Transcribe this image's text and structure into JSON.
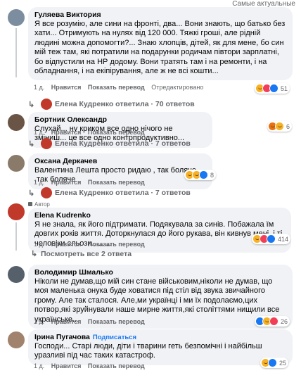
{
  "top_fragment": "Самые актуальные",
  "comments": [
    {
      "author": "Гуляева Виктория",
      "text": "Я все розумію, але сини на фронті, два... Вони знають, що батько без хати... Отримують на нулях від 120 000. Тяжкі гроші, але рідній людині можна допомогти?... Знаю хлопців, дітей, як для мене, бо син мій теж там, які потратили на подарунки родичам півтори зарплатні, бо відпустили на НР додому. Вони тратять там і на ремонти, і на обладнання, і на екіпірування, але ж не всі кошти...",
      "time": "1 д.",
      "like": "Нравится",
      "translate": "Показать перевод",
      "edited": "Отредактировано",
      "reactions": "51",
      "reply_summary": "Елена Кудренко ответила · 70 ответов"
    },
    {
      "author": "Бортник Олександр",
      "text": "Слухай... ну криком все одно нічого не зміниш... це все одно контрпродуктивно...",
      "time": "1 д.",
      "like": "Нравится",
      "translate": "Показать перевод",
      "reactions": "6",
      "reply_summary": "Елена Кудренко ответила · 7 ответов"
    },
    {
      "author": "Оксана Деркачев",
      "text": "Валентина Лешта просто ридаю , так боляче ,так боляче",
      "time": "1 д.",
      "like": "Нравится",
      "translate": "Показать перевод",
      "reactions": "8",
      "reply_summary": "Елена Кудренко ответила · 7 ответов"
    },
    {
      "badge": "Автор",
      "author": "Elena Kudrenko",
      "text": "Я не знала, як його підтримати. Подякувала за синів. Побажала їм довгих років життя. Доторкнулася до його рукава, він кивнув мені, і ті чоловіки сльози.........",
      "time": "1 д.",
      "like": "Нравится",
      "translate": "Показать перевод",
      "reactions": "414",
      "more_replies": "Посмотреть все 2 ответа"
    },
    {
      "author": "Володимир Шмалько",
      "text": "Ніколи не думав,що мій син стане військовим,ніколи не думав, що моя маленька онука буде ховатися під стіл від звука звичайного грому. Але так сталося. Але,ми українці і ми їх подолаємо,цих потвор,які зруйнували наше мирне життя,які століттями нищили все українське...",
      "time": "1 д.",
      "like": "Нравится",
      "translate": "Показать перевод",
      "reactions": "26"
    },
    {
      "author": "Ірина Пугачова",
      "follow": "Подписаться",
      "text": "Господи... Старі люди, діти і тварини геть безпомічні і найбільш уразливі під час таких катастроф.",
      "time": "1 д.",
      "like": "Нравится",
      "translate": "Показать перевод",
      "reactions": "25"
    }
  ]
}
